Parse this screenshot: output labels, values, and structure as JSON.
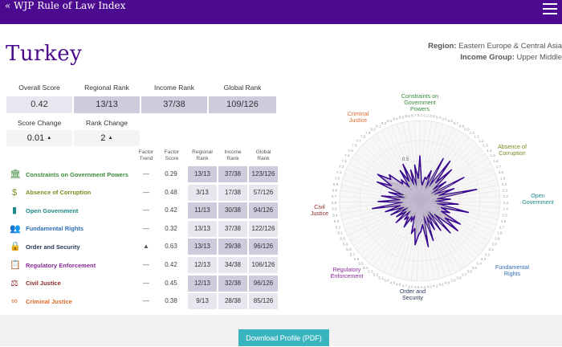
{
  "header": {
    "back_label": "« WJP Rule of Law Index",
    "menu_icon": "hamburger-menu-icon"
  },
  "country": "Turkey",
  "meta": {
    "region_key": "Region:",
    "region_value": "Eastern Europe & Central Asia",
    "income_key": "Income Group:",
    "income_value": "Upper Middle"
  },
  "summary": {
    "headers": [
      "Overall Score",
      "Regional Rank",
      "Income Rank",
      "Global Rank"
    ],
    "values": [
      "0.42",
      "13/13",
      "37/38",
      "109/126"
    ],
    "score_change_label": "Score Change",
    "score_change_value": "0.01",
    "rank_change_label": "Rank Change",
    "rank_change_value": "2"
  },
  "table": {
    "columns": [
      "Factor\nTrend",
      "Factor\nScore",
      "Regional\nRank",
      "Income\nRank",
      "Global\nRank"
    ],
    "rows": [
      {
        "label": "Constraints on Government Powers",
        "color": "#3a8a3a",
        "icon": "government-building-icon",
        "glyph": "🏛",
        "trend": "—",
        "score": "0.29",
        "rr": "13/13",
        "ir": "37/38",
        "gr": "123/126"
      },
      {
        "label": "Absence of Corruption",
        "color": "#7a8a1f",
        "icon": "money-bag-icon",
        "glyph": "$",
        "trend": "—",
        "score": "0.48",
        "rr": "3/13",
        "ir": "17/38",
        "gr": "57/126"
      },
      {
        "label": "Open Government",
        "color": "#1f8a8a",
        "icon": "open-door-icon",
        "glyph": "▮",
        "trend": "—",
        "score": "0.42",
        "rr": "11/13",
        "ir": "30/38",
        "gr": "94/126"
      },
      {
        "label": "Fundamental Rights",
        "color": "#2f6fb8",
        "icon": "people-icon",
        "glyph": "👥",
        "trend": "—",
        "score": "0.32",
        "rr": "13/13",
        "ir": "37/38",
        "gr": "122/126"
      },
      {
        "label": "Order and Security",
        "color": "#2a3a5a",
        "icon": "padlock-icon",
        "glyph": "🔒",
        "trend": "▲",
        "score": "0.63",
        "rr": "13/13",
        "ir": "29/38",
        "gr": "96/126"
      },
      {
        "label": "Regulatory Enforcement",
        "color": "#8a2a9a",
        "icon": "clipboard-icon",
        "glyph": "📋",
        "trend": "—",
        "score": "0.42",
        "rr": "12/13",
        "ir": "34/38",
        "gr": "106/126"
      },
      {
        "label": "Civil Justice",
        "color": "#8a2a2a",
        "icon": "scales-icon",
        "glyph": "⚖",
        "trend": "—",
        "score": "0.45",
        "rr": "12/13",
        "ir": "32/38",
        "gr": "96/126"
      },
      {
        "label": "Criminal Justice",
        "color": "#e06a2a",
        "icon": "handcuffs-icon",
        "glyph": "∞",
        "trend": "—",
        "score": "0.38",
        "rr": "9/13",
        "ir": "28/38",
        "gr": "85/126"
      }
    ]
  },
  "chart_data": {
    "type": "radar",
    "axes": [
      "Constraints on Government Powers",
      "Absence of Corruption",
      "Open Government",
      "Fundamental Rights",
      "Order and Security",
      "Regulatory Enforcement",
      "Civil Justice",
      "Criminal Justice"
    ],
    "axis_colors": [
      "#3a8a3a",
      "#7a8a1f",
      "#1f8a8a",
      "#2f6fb8",
      "#2a3a5a",
      "#8a2a9a",
      "#8a2a2a",
      "#e06a2a"
    ],
    "axis_labels_display": [
      [
        "Constraints on",
        "Government",
        "Powers"
      ],
      [
        "Absence of",
        "Corruption"
      ],
      [
        "Open",
        "Government"
      ],
      [
        "Fundamental",
        "Rights"
      ],
      [
        "Order and",
        "Security"
      ],
      [
        "Regulatory",
        "Enforcement"
      ],
      [
        "Civil",
        "Justice"
      ],
      [
        "Criminal",
        "Justice"
      ]
    ],
    "scale_range": [
      0,
      1
    ],
    "scale_tick": "0.5",
    "ring_ticks": [
      "0.1",
      "0.2",
      "0.3",
      "0.4",
      "0.5",
      "0.6",
      "0.7",
      "0.8",
      "0.9",
      "1.0",
      "1.1",
      "1.2",
      "1.3",
      "1.4",
      "1.5",
      "1.6",
      "1.7",
      "1.8",
      "1.9",
      "2.0",
      "2.1",
      "2.2",
      "2.3",
      "2.4",
      "2.5",
      "2.6",
      "2.7",
      "2.8",
      "2.9",
      "3.0",
      "3.1",
      "3.2",
      "3.3",
      "3.4",
      "3.5",
      "3.6",
      "3.7",
      "3.8",
      "3.9",
      "4.0",
      "4.1",
      "4.2",
      "4.3",
      "4.4",
      "4.5",
      "4.6",
      "4.7",
      "4.8",
      "4.9",
      "5.0",
      "5.1",
      "5.2",
      "5.3",
      "5.4",
      "5.5",
      "5.6",
      "5.7",
      "5.8",
      "5.9",
      "6.0",
      "6.1",
      "6.2",
      "6.3",
      "6.4",
      "6.5",
      "6.6",
      "6.7",
      "6.8",
      "6.9",
      "7.0",
      "7.1",
      "7.2",
      "7.3",
      "7.4",
      "7.5",
      "7.6",
      "7.7",
      "7.8",
      "7.9",
      "8.0",
      "8.1",
      "8.2",
      "8.3",
      "8.4",
      "8.5",
      "8.6",
      "8.7"
    ],
    "series": [
      {
        "values": [
          0.56,
          0.25,
          0.2,
          0.3,
          0.28,
          0.4,
          0.18,
          0.6,
          0.22,
          0.62,
          0.3,
          0.55,
          0.22,
          0.4,
          0.18,
          0.62,
          0.2,
          0.45,
          0.25,
          0.72,
          0.22,
          0.38,
          0.2,
          0.48,
          0.22,
          0.62,
          0.28,
          0.4,
          0.3,
          0.58,
          0.38,
          0.6,
          0.25,
          0.55,
          0.18,
          0.45,
          0.2,
          0.4,
          0.22,
          0.52,
          0.2,
          0.58,
          0.3,
          0.38,
          0.42,
          0.55,
          0.35,
          0.42,
          0.2,
          0.28,
          0.22,
          0.38,
          0.25,
          0.3,
          0.18,
          0.4,
          0.22,
          0.35,
          0.18,
          0.4,
          0.22,
          0.45,
          0.25,
          0.6,
          0.22,
          0.52,
          0.25,
          0.48,
          0.2,
          0.4,
          0.22,
          0.58,
          0.4,
          0.62,
          0.45,
          0.5,
          0.3,
          0.35,
          0.22,
          0.45,
          0.28,
          0.5,
          0.22,
          0.4,
          0.2,
          0.45,
          0.28
        ]
      }
    ]
  },
  "footer": {
    "download_label": "Download Profile (PDF)"
  }
}
